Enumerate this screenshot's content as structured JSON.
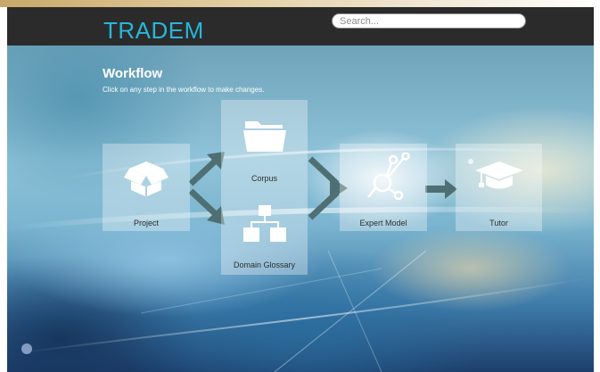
{
  "header": {
    "brand": "TRADEM",
    "search_placeholder": "Search..."
  },
  "workflow": {
    "title": "Workflow",
    "subtitle": "Click on any step in the workflow to make changes.",
    "steps": [
      {
        "label": "Project",
        "icon": "open-box-icon"
      },
      {
        "label": "Corpus",
        "icon": "folder-icon"
      },
      {
        "label": "Domain Glossary",
        "icon": "hierarchy-icon"
      },
      {
        "label": "Expert Model",
        "icon": "network-node-icon"
      },
      {
        "label": "Tutor",
        "icon": "graduation-cap-icon"
      }
    ]
  },
  "colors": {
    "header_bg": "#2b2b2b",
    "brand": "#29b6d8",
    "arrow": "#4e6f73"
  }
}
